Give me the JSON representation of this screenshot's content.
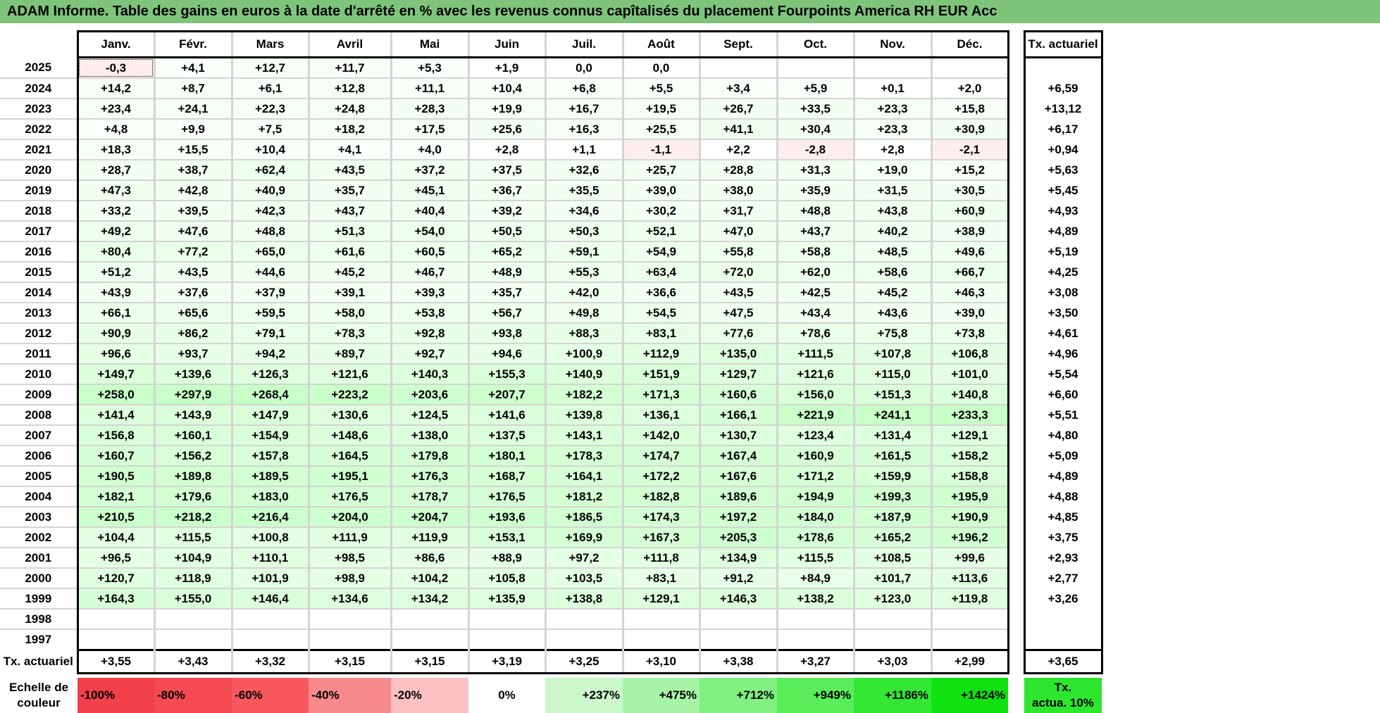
{
  "title": "ADAM Informe. Table des gains en euros à la date d'arrêté en % avec les revenus connus capîtalisés du placement Fourpoints America RH EUR Acc",
  "months": [
    "Janv.",
    "Févr.",
    "Mars",
    "Avril",
    "Mai",
    "Juin",
    "Juil.",
    "Août",
    "Sept.",
    "Oct.",
    "Nov.",
    "Déc."
  ],
  "actuarial_header": "Tx. actuariel",
  "rows": [
    {
      "year": "2025",
      "values": [
        "-0,3",
        "+4,1",
        "+12,7",
        "+11,7",
        "+5,3",
        "+1,9",
        "0,0",
        "0,0",
        "",
        "",
        "",
        ""
      ],
      "actuarial": ""
    },
    {
      "year": "2024",
      "values": [
        "+14,2",
        "+8,7",
        "+6,1",
        "+12,8",
        "+11,1",
        "+10,4",
        "+6,8",
        "+5,5",
        "+3,4",
        "+5,9",
        "+0,1",
        "+2,0"
      ],
      "actuarial": "+6,59"
    },
    {
      "year": "2023",
      "values": [
        "+23,4",
        "+24,1",
        "+22,3",
        "+24,8",
        "+28,3",
        "+19,9",
        "+16,7",
        "+19,5",
        "+26,7",
        "+33,5",
        "+23,3",
        "+15,8"
      ],
      "actuarial": "+13,12"
    },
    {
      "year": "2022",
      "values": [
        "+4,8",
        "+9,9",
        "+7,5",
        "+18,2",
        "+17,5",
        "+25,6",
        "+16,3",
        "+25,5",
        "+41,1",
        "+30,4",
        "+23,3",
        "+30,9"
      ],
      "actuarial": "+6,17"
    },
    {
      "year": "2021",
      "values": [
        "+18,3",
        "+15,5",
        "+10,4",
        "+4,1",
        "+4,0",
        "+2,8",
        "+1,1",
        "-1,1",
        "+2,2",
        "-2,8",
        "+2,8",
        "-2,1"
      ],
      "actuarial": "+0,94"
    },
    {
      "year": "2020",
      "values": [
        "+28,7",
        "+38,7",
        "+62,4",
        "+43,5",
        "+37,2",
        "+37,5",
        "+32,6",
        "+25,7",
        "+28,8",
        "+31,3",
        "+19,0",
        "+15,2"
      ],
      "actuarial": "+5,63"
    },
    {
      "year": "2019",
      "values": [
        "+47,3",
        "+42,8",
        "+40,9",
        "+35,7",
        "+45,1",
        "+36,7",
        "+35,5",
        "+39,0",
        "+38,0",
        "+35,9",
        "+31,5",
        "+30,5"
      ],
      "actuarial": "+5,45"
    },
    {
      "year": "2018",
      "values": [
        "+33,2",
        "+39,5",
        "+42,3",
        "+43,7",
        "+40,4",
        "+39,2",
        "+34,6",
        "+30,2",
        "+31,7",
        "+48,8",
        "+43,8",
        "+60,9"
      ],
      "actuarial": "+4,93"
    },
    {
      "year": "2017",
      "values": [
        "+49,2",
        "+47,6",
        "+48,8",
        "+51,3",
        "+54,0",
        "+50,5",
        "+50,3",
        "+52,1",
        "+47,0",
        "+43,7",
        "+40,2",
        "+38,9"
      ],
      "actuarial": "+4,89"
    },
    {
      "year": "2016",
      "values": [
        "+80,4",
        "+77,2",
        "+65,0",
        "+61,6",
        "+60,5",
        "+65,2",
        "+59,1",
        "+54,9",
        "+55,8",
        "+58,8",
        "+48,5",
        "+49,6"
      ],
      "actuarial": "+5,19"
    },
    {
      "year": "2015",
      "values": [
        "+51,2",
        "+43,5",
        "+44,6",
        "+45,2",
        "+46,7",
        "+48,9",
        "+55,3",
        "+63,4",
        "+72,0",
        "+62,0",
        "+58,6",
        "+66,7"
      ],
      "actuarial": "+4,25"
    },
    {
      "year": "2014",
      "values": [
        "+43,9",
        "+37,6",
        "+37,9",
        "+39,1",
        "+39,3",
        "+35,7",
        "+42,0",
        "+36,6",
        "+43,5",
        "+42,5",
        "+45,2",
        "+46,3"
      ],
      "actuarial": "+3,08"
    },
    {
      "year": "2013",
      "values": [
        "+66,1",
        "+65,6",
        "+59,5",
        "+58,0",
        "+53,8",
        "+56,7",
        "+49,8",
        "+54,5",
        "+47,5",
        "+43,4",
        "+43,6",
        "+39,0"
      ],
      "actuarial": "+3,50"
    },
    {
      "year": "2012",
      "values": [
        "+90,9",
        "+86,2",
        "+79,1",
        "+78,3",
        "+92,8",
        "+93,8",
        "+88,3",
        "+83,1",
        "+77,6",
        "+78,6",
        "+75,8",
        "+73,8"
      ],
      "actuarial": "+4,61"
    },
    {
      "year": "2011",
      "values": [
        "+96,6",
        "+93,7",
        "+94,2",
        "+89,7",
        "+92,7",
        "+94,6",
        "+100,9",
        "+112,9",
        "+135,0",
        "+111,5",
        "+107,8",
        "+106,8"
      ],
      "actuarial": "+4,96"
    },
    {
      "year": "2010",
      "values": [
        "+149,7",
        "+139,6",
        "+126,3",
        "+121,6",
        "+140,3",
        "+155,3",
        "+140,9",
        "+151,9",
        "+129,7",
        "+121,6",
        "+115,0",
        "+101,0"
      ],
      "actuarial": "+5,54"
    },
    {
      "year": "2009",
      "values": [
        "+258,0",
        "+297,9",
        "+268,4",
        "+223,2",
        "+203,6",
        "+207,7",
        "+182,2",
        "+171,3",
        "+160,6",
        "+156,0",
        "+151,3",
        "+140,8"
      ],
      "actuarial": "+6,60"
    },
    {
      "year": "2008",
      "values": [
        "+141,4",
        "+143,9",
        "+147,9",
        "+130,6",
        "+124,5",
        "+141,6",
        "+139,8",
        "+136,1",
        "+166,1",
        "+221,9",
        "+241,1",
        "+233,3"
      ],
      "actuarial": "+5,51"
    },
    {
      "year": "2007",
      "values": [
        "+156,8",
        "+160,1",
        "+154,9",
        "+148,6",
        "+138,0",
        "+137,5",
        "+143,1",
        "+142,0",
        "+130,7",
        "+123,4",
        "+131,4",
        "+129,1"
      ],
      "actuarial": "+4,80"
    },
    {
      "year": "2006",
      "values": [
        "+160,7",
        "+156,2",
        "+157,8",
        "+164,5",
        "+179,8",
        "+180,1",
        "+178,3",
        "+174,7",
        "+167,4",
        "+160,9",
        "+161,5",
        "+158,2"
      ],
      "actuarial": "+5,09"
    },
    {
      "year": "2005",
      "values": [
        "+190,5",
        "+189,8",
        "+189,5",
        "+195,1",
        "+176,3",
        "+168,7",
        "+164,1",
        "+172,2",
        "+167,6",
        "+171,2",
        "+159,9",
        "+158,8"
      ],
      "actuarial": "+4,89"
    },
    {
      "year": "2004",
      "values": [
        "+182,1",
        "+179,6",
        "+183,0",
        "+176,5",
        "+178,7",
        "+176,5",
        "+181,2",
        "+182,8",
        "+189,6",
        "+194,9",
        "+199,3",
        "+195,9"
      ],
      "actuarial": "+4,88"
    },
    {
      "year": "2003",
      "values": [
        "+210,5",
        "+218,2",
        "+216,4",
        "+204,0",
        "+204,7",
        "+193,6",
        "+186,5",
        "+174,3",
        "+197,2",
        "+184,0",
        "+187,9",
        "+190,9"
      ],
      "actuarial": "+4,85"
    },
    {
      "year": "2002",
      "values": [
        "+104,4",
        "+115,5",
        "+100,8",
        "+111,9",
        "+119,9",
        "+153,1",
        "+169,9",
        "+167,3",
        "+205,3",
        "+178,6",
        "+165,2",
        "+196,2"
      ],
      "actuarial": "+3,75"
    },
    {
      "year": "2001",
      "values": [
        "+96,5",
        "+104,9",
        "+110,1",
        "+98,5",
        "+86,6",
        "+88,9",
        "+97,2",
        "+111,8",
        "+134,9",
        "+115,5",
        "+108,5",
        "+99,6"
      ],
      "actuarial": "+2,93"
    },
    {
      "year": "2000",
      "values": [
        "+120,7",
        "+118,9",
        "+101,9",
        "+98,9",
        "+104,2",
        "+105,8",
        "+103,5",
        "+83,1",
        "+91,2",
        "+84,9",
        "+101,7",
        "+113,6"
      ],
      "actuarial": "+2,77"
    },
    {
      "year": "1999",
      "values": [
        "+164,3",
        "+155,0",
        "+146,4",
        "+134,6",
        "+134,2",
        "+135,9",
        "+138,8",
        "+129,1",
        "+146,3",
        "+138,2",
        "+123,0",
        "+119,8"
      ],
      "actuarial": "+3,26"
    },
    {
      "year": "1998",
      "values": [
        "",
        "",
        "",
        "",
        "",
        "",
        "",
        "",
        "",
        "",
        "",
        ""
      ],
      "actuarial": ""
    },
    {
      "year": "1997",
      "values": [
        "",
        "",
        "",
        "",
        "",
        "",
        "",
        "",
        "",
        "",
        "",
        ""
      ],
      "actuarial": ""
    }
  ],
  "footer": {
    "label": "Tx. actuariel",
    "values": [
      "+3,55",
      "+3,43",
      "+3,32",
      "+3,15",
      "+3,15",
      "+3,19",
      "+3,25",
      "+3,10",
      "+3,38",
      "+3,27",
      "+3,03",
      "+2,99"
    ],
    "actuarial": "+3,65"
  },
  "scale": {
    "label_line1": "Echelle de",
    "label_line2": "couleur",
    "swatches": [
      {
        "text": "-100%",
        "color": "#f2404a",
        "align": "left"
      },
      {
        "text": "-80%",
        "color": "#f44a52",
        "align": "left"
      },
      {
        "text": "-60%",
        "color": "#f6585e",
        "align": "left"
      },
      {
        "text": "-40%",
        "color": "#f88a8e",
        "align": "left"
      },
      {
        "text": "-20%",
        "color": "#fbc0c2",
        "align": "left"
      },
      {
        "text": "0%",
        "color": "#ffffff",
        "align": "center"
      },
      {
        "text": "+237%",
        "color": "#ccf7cc",
        "align": "right"
      },
      {
        "text": "+475%",
        "color": "#a6f5a6",
        "align": "right"
      },
      {
        "text": "+712%",
        "color": "#80f080",
        "align": "right"
      },
      {
        "text": "+949%",
        "color": "#59ee59",
        "align": "right"
      },
      {
        "text": "+1186%",
        "color": "#33e833",
        "align": "right"
      },
      {
        "text": "+1424%",
        "color": "#0fe20f",
        "align": "right"
      }
    ],
    "actuarial_line1": "Tx.",
    "actuarial_line2": "actua. 10%",
    "actuarial_color": "#2ee62e"
  },
  "colors": {
    "title_bg": "#7ec47a",
    "negative_cell": "#fdeeee",
    "positive_scale_max": 1424
  }
}
